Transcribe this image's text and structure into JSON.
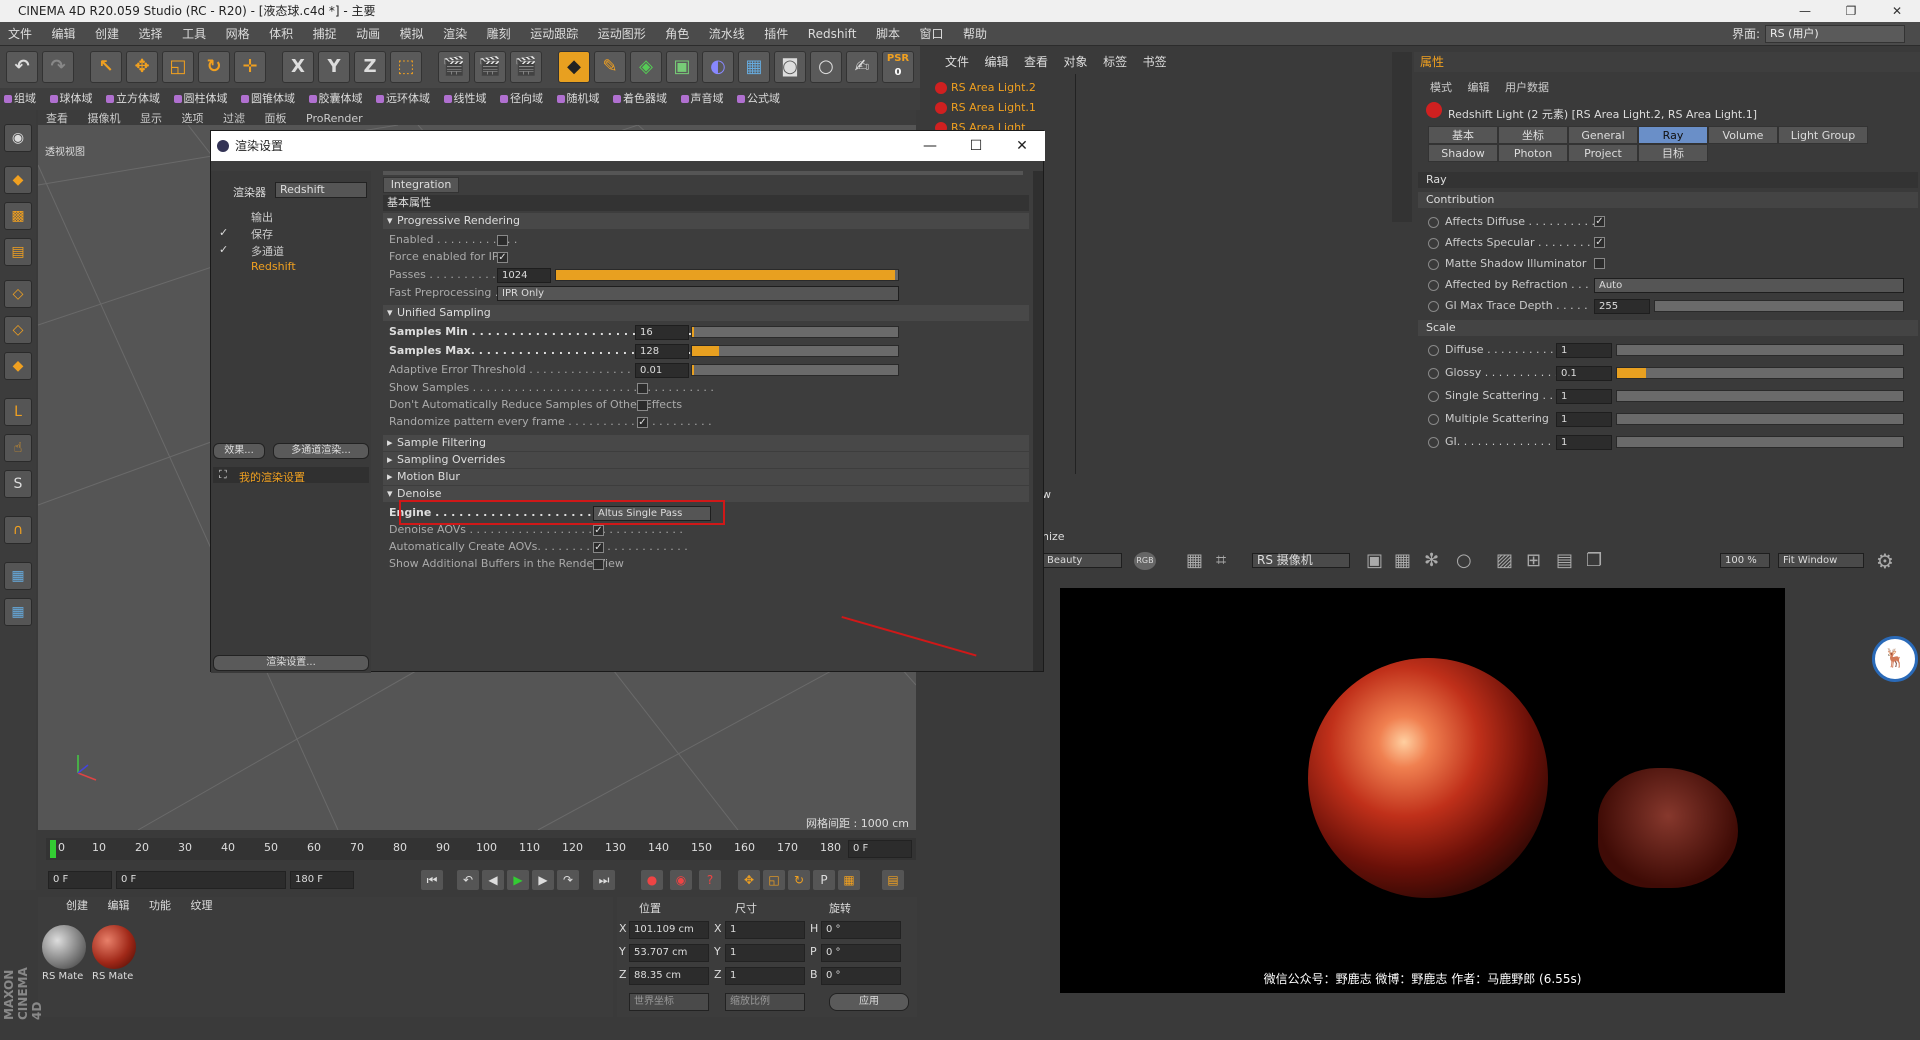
{
  "titlebar": {
    "title": "CINEMA 4D R20.059 Studio (RC - R20) - [液态球.c4d *] - 主要",
    "min": "—",
    "max": "❐",
    "close": "✕"
  },
  "menubar": {
    "items": [
      "文件",
      "编辑",
      "创建",
      "选择",
      "工具",
      "网格",
      "体积",
      "捕捉",
      "动画",
      "模拟",
      "渲染",
      "雕刻",
      "运动跟踪",
      "运动图形",
      "角色",
      "流水线",
      "插件",
      "Redshift",
      "脚本",
      "窗口",
      "帮助"
    ],
    "layout_label": "界面:",
    "layout_value": "RS (用户)"
  },
  "toolbar": {
    "psr": "PSR",
    "psr_value": "0",
    "x": "X",
    "y": "Y",
    "z": "Z"
  },
  "subtoolbar": {
    "items": [
      "组域",
      "球体域",
      "立方体域",
      "圆柱体域",
      "圆锥体域",
      "胶囊体域",
      "远环体域",
      "线性域",
      "径向域",
      "随机域",
      "着色器域",
      "声音域",
      "公式域"
    ]
  },
  "viewport": {
    "menu": [
      "查看",
      "摄像机",
      "显示",
      "选项",
      "过滤",
      "面板",
      "ProRender"
    ],
    "label": "透视视图",
    "grid_distance": "网格间距 : 1000 cm"
  },
  "timeline": {
    "ticks": [
      "0",
      "10",
      "20",
      "30",
      "40",
      "50",
      "60",
      "70",
      "80",
      "90",
      "100",
      "110",
      "120",
      "130",
      "140",
      "150",
      "160",
      "170",
      "180"
    ],
    "current_field": "0 F"
  },
  "transport": {
    "start": "0 F",
    "range_start": "0 F",
    "range_end": "180 F",
    "end": "180 F"
  },
  "materials": {
    "menu": [
      "创建",
      "编辑",
      "功能",
      "纹理"
    ],
    "items": [
      "RS Mate",
      "RS Mate"
    ]
  },
  "coords": {
    "headers": [
      "位置",
      "尺寸",
      "旋转"
    ],
    "pos": {
      "x": "101.109 cm",
      "y": "53.707 cm",
      "z": "88.35 cm"
    },
    "size": {
      "x": "1",
      "y": "1",
      "z": "1"
    },
    "rot": {
      "h": "0 °",
      "p": "0 °",
      "b": "0 °"
    },
    "axis_labels": {
      "x": "X",
      "y": "Y",
      "z": "Z",
      "h": "H",
      "p": "P",
      "b": "B"
    },
    "world": "世界坐标",
    "scale": "缩放比例",
    "apply": "应用"
  },
  "brand": "MAXON CINEMA 4D",
  "objects": {
    "menu": [
      "文件",
      "编辑",
      "查看",
      "对象",
      "标签",
      "书签"
    ],
    "rows": [
      "RS Area Light.2",
      "RS Area Light.1",
      "RS Area Light"
    ]
  },
  "attributes": {
    "header": "属性",
    "menu": [
      "模式",
      "编辑",
      "用户数据"
    ],
    "title": "Redshift Light (2 元素) [RS Area Light.2, RS Area Light.1]",
    "tabs": [
      "基本",
      "坐标",
      "General",
      "Ray",
      "Volume",
      "Light Group",
      "Shadow",
      "Photon",
      "Project",
      "目标"
    ],
    "section": "Ray",
    "contribution": "Contribution",
    "rows": [
      {
        "label": "Affects Diffuse . . . . . . . . . .",
        "check": "✓"
      },
      {
        "label": "Affects Specular . . . . . . . .",
        "check": "✓"
      },
      {
        "label": "Matte Shadow Illuminator",
        "check": ""
      },
      {
        "label": "Affected by Refraction . . .",
        "value": "Auto"
      },
      {
        "label": "GI Max Trace Depth . . . . .",
        "value": "255"
      }
    ],
    "scale": "Scale",
    "scale_rows": [
      {
        "label": "Diffuse . . . . . . . . . . .",
        "value": "1"
      },
      {
        "label": "Glossy . . . . . . . . . . .",
        "value": "0.1"
      },
      {
        "label": "Single Scattering . .",
        "value": "1"
      },
      {
        "label": "Multiple Scattering",
        "value": "1"
      },
      {
        "label": "GI. . . . . . . . . . . . . .",
        "value": "1"
      }
    ],
    "glossy_fraction": 0.1
  },
  "renderview": {
    "partial_tab": "w",
    "partial_label": "nize",
    "aov": "Beauty",
    "rgb": "RGB",
    "camera": "RS 摄像机",
    "zoom": "100 %",
    "fit": "Fit Window",
    "caption": "微信公众号：野鹿志  微博：野鹿志  作者：马鹿野郎  (6.55s)"
  },
  "dialog": {
    "title": "渲染设置",
    "renderer_label": "渲染器",
    "renderer_value": "Redshift",
    "left_items": [
      "输出",
      "保存",
      "多通道",
      "Redshift"
    ],
    "left_checks": [
      "",
      "✓",
      "✓",
      ""
    ],
    "effects_button": "效果...",
    "multipass_button": "多通道渲染...",
    "preset": "我的渲染设置",
    "settings_button": "渲染设置...",
    "tab_integration": "Integration",
    "group_basic": "基本属性",
    "sections": {
      "progressive": "Progressive Rendering",
      "unified": "Unified Sampling",
      "filtering": "Sample Filtering",
      "overrides": "Sampling Overrides",
      "motion": "Motion Blur",
      "denoise": "Denoise"
    },
    "rows": {
      "enabled": "Enabled . . . . . . . . . . . .",
      "force_ipr": "Force enabled for IPR",
      "passes": "Passes . . . . . . . . . . . . .",
      "passes_value": "1024",
      "fast_pre": "Fast Preprocessing . . .",
      "fast_pre_value": "IPR Only",
      "smin": "Samples Min . . . . . . . . . . . . . . . . . . . . . . . . . . . . . . . . . . . . .",
      "smin_value": "16",
      "smax": "Samples Max. . . . . . . . . . . . . . . . . . . . . . . . . . . . . . . . . . . . .",
      "smax_value": "128",
      "aet": "Adaptive Error Threshold . . . . . . . . . . . . . . . . . . . . . . . . . . .",
      "aet_value": "0.01",
      "show_samples": "Show Samples . . . . . . . . . . . . . . . . . . . . . . . . . . . . . . . . . . .",
      "no_reduce": "Don't Automatically Reduce Samples of Other Effects",
      "randomize": "Randomize pattern every frame . . . . . . . . . . . . . . . . . . . . .",
      "engine": "Engine . . . . . . . . . . . . . . . . . . . . . . . . . . . . . . . . . .",
      "engine_value": "Altus Single Pass",
      "denoise_aovs": "Denoise AOVs . . . . . . . . . . . . . . . . . . . . . . . . . . . . . . .",
      "auto_aovs": "Automatically Create AOVs. . . . . . . . . . . . . . . . . . . . . .",
      "show_buffers": "Show Additional Buffers in the RenderView"
    },
    "checks": {
      "force_ipr": "✓",
      "randomize": "✓",
      "denoise_aovs": "✓",
      "auto_aovs": "✓"
    },
    "passes_fraction": 0.99,
    "smin_fraction": 0.01,
    "smax_fraction": 0.13,
    "aet_fraction": 0.01
  }
}
